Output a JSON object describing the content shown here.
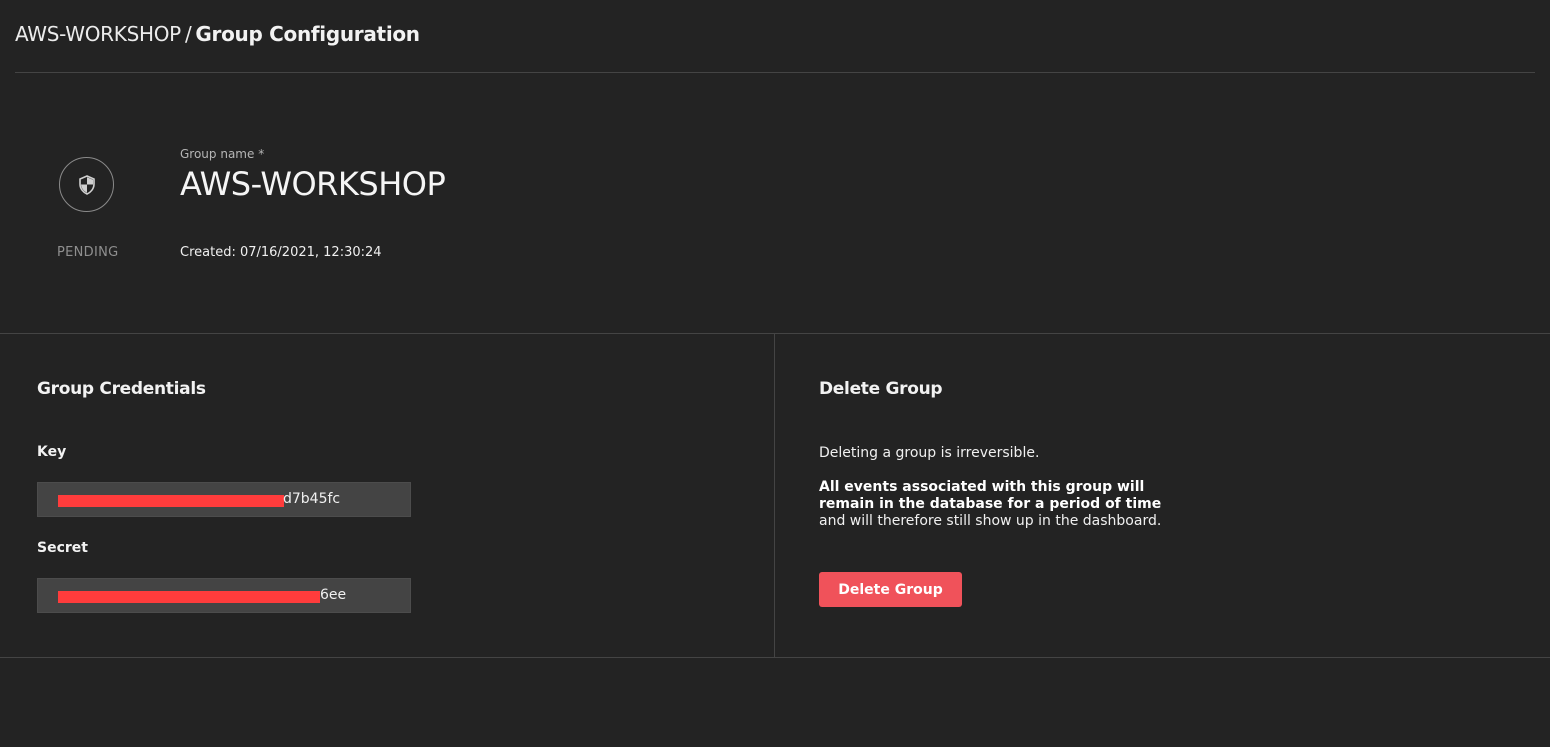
{
  "header": {
    "breadcrumb_parent": "AWS-WORKSHOP",
    "breadcrumb_separator": "/",
    "breadcrumb_current": "Group Configuration"
  },
  "summary": {
    "status_icon": "shield-icon",
    "status": "PENDING",
    "name_label": "Group name *",
    "name_value": "AWS-WORKSHOP",
    "created": "Created: 07/16/2021, 12:30:24"
  },
  "credentials": {
    "title": "Group Credentials",
    "key_label": "Key",
    "key_visible_suffix": "d7b45fc",
    "secret_label": "Secret",
    "secret_visible_suffix": "6ee"
  },
  "delete_group": {
    "title": "Delete Group",
    "irreversible_text": "Deleting a group is irreversible.",
    "events_bold": "All events associated with this group will remain in the database for a period of time",
    "events_rest": " and will therefore still show up in the dashboard.",
    "button_label": "Delete Group"
  },
  "colors": {
    "background": "#232323",
    "divider": "#444444",
    "field_background": "#444444",
    "redaction": "#ff3c3c",
    "danger_button": "#f0525a"
  }
}
